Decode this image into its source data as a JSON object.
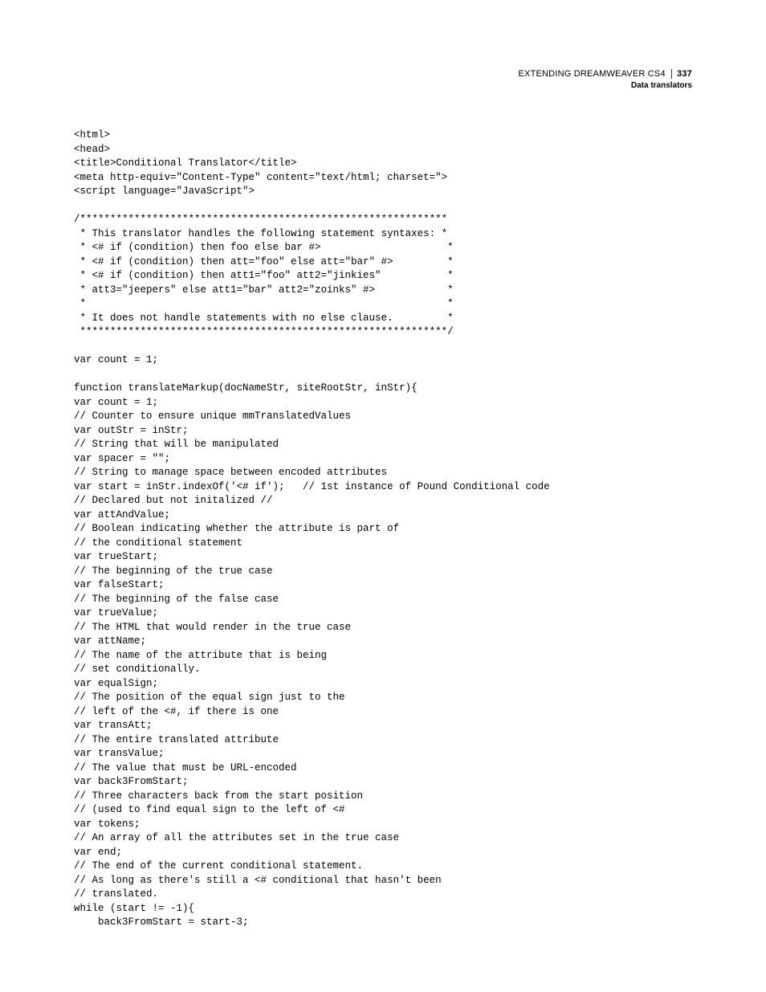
{
  "header": {
    "title": "EXTENDING DREAMWEAVER CS4",
    "page_number": "337",
    "section": "Data translators"
  },
  "code": {
    "lines": [
      "<html>",
      "<head>",
      "<title>Conditional Translator</title>",
      "<meta http-equiv=\"Content-Type\" content=\"text/html; charset=\">",
      "<script language=\"JavaScript\">",
      "",
      "/*************************************************************",
      " * This translator handles the following statement syntaxes: *",
      " * <# if (condition) then foo else bar #>                     *",
      " * <# if (condition) then att=\"foo\" else att=\"bar\" #>         *",
      " * <# if (condition) then att1=\"foo\" att2=\"jinkies\"           *",
      " * att3=\"jeepers\" else att1=\"bar\" att2=\"zoinks\" #>            *",
      " *                                                            *",
      " * It does not handle statements with no else clause.         *",
      " *************************************************************/",
      "",
      "var count = 1;",
      "",
      "function translateMarkup(docNameStr, siteRootStr, inStr){",
      "var count = 1;",
      "// Counter to ensure unique mmTranslatedValues",
      "var outStr = inStr;",
      "// String that will be manipulated",
      "var spacer = \"\";",
      "// String to manage space between encoded attributes",
      "var start = inStr.indexOf('<# if');   // 1st instance of Pound Conditional code",
      "// Declared but not initalized //",
      "var attAndValue;",
      "// Boolean indicating whether the attribute is part of",
      "// the conditional statement",
      "var trueStart;",
      "// The beginning of the true case",
      "var falseStart;",
      "// The beginning of the false case",
      "var trueValue;",
      "// The HTML that would render in the true case",
      "var attName;",
      "// The name of the attribute that is being",
      "// set conditionally.",
      "var equalSign;",
      "// The position of the equal sign just to the",
      "// left of the <#, if there is one",
      "var transAtt;",
      "// The entire translated attribute",
      "var transValue;",
      "// The value that must be URL-encoded",
      "var back3FromStart;",
      "// Three characters back from the start position",
      "// (used to find equal sign to the left of <#",
      "var tokens;",
      "// An array of all the attributes set in the true case",
      "var end;",
      "// The end of the current conditional statement.",
      "// As long as there's still a <# conditional that hasn't been",
      "// translated.",
      "while (start != -1){",
      "    back3FromStart = start-3;"
    ]
  }
}
